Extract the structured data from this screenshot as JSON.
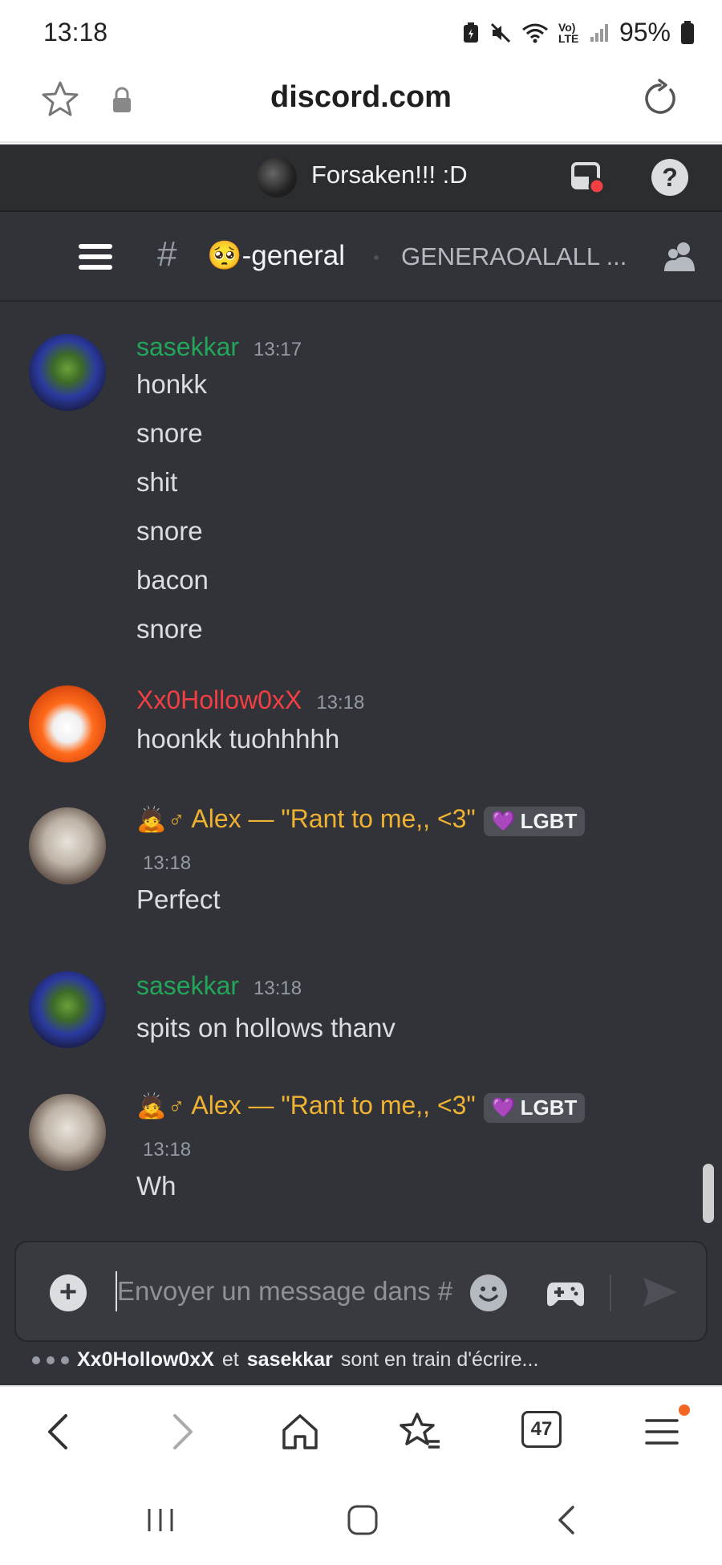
{
  "status_bar": {
    "time": "13:18",
    "battery": "95%",
    "icons": [
      "battery-saver-icon",
      "mute-icon",
      "wifi-icon",
      "volte-icon",
      "signal-icon",
      "battery-icon"
    ],
    "volte_label": "Vo) LTE"
  },
  "browser": {
    "domain": "discord.com",
    "tab_count": "47",
    "icons": [
      "star-icon",
      "lock-icon",
      "reload-icon",
      "back-icon",
      "forward-icon",
      "home-icon",
      "bookmarks-icon",
      "tabs-icon",
      "menu-icon"
    ]
  },
  "server": {
    "name": "Forsaken!!! :D"
  },
  "channel": {
    "hash": "#",
    "name": "🥺-general",
    "topic": "GENERAOALALL ..."
  },
  "messages": [
    {
      "author": "sasekkar",
      "author_color": "#23a55a",
      "time": "13:17",
      "lines": [
        "honkk",
        "snore",
        "shit",
        "snore",
        "bacon",
        "snore"
      ]
    },
    {
      "author": "Xx0Hollow0xX",
      "author_color": "#f23f43",
      "time": "13:18",
      "lines": [
        "hoonkk tuohhhhh"
      ]
    },
    {
      "author_emoji": "🙇",
      "author_symbol": "♂",
      "author": "Alex — \"Rant to me,, <3\"",
      "author_color": "#f0b232",
      "tag": "LGBT",
      "tag_emoji": "💜",
      "time": "13:18",
      "lines": [
        "Perfect"
      ]
    },
    {
      "author": "sasekkar",
      "author_color": "#23a55a",
      "time": "13:18",
      "lines": [
        "spits on hollows thanv"
      ]
    },
    {
      "author_emoji": "🙇",
      "author_symbol": "♂",
      "author": "Alex — \"Rant to me,, <3\"",
      "author_color": "#f0b232",
      "tag": "LGBT",
      "tag_emoji": "💜",
      "time": "13:18",
      "lines": [
        "Wh"
      ]
    }
  ],
  "composer": {
    "placeholder": "Envoyer un message dans #",
    "typing_user_1": "Xx0Hollow0xX",
    "typing_and": "et",
    "typing_user_2": "sasekkar",
    "typing_suffix": "sont en train d'écrire..."
  }
}
